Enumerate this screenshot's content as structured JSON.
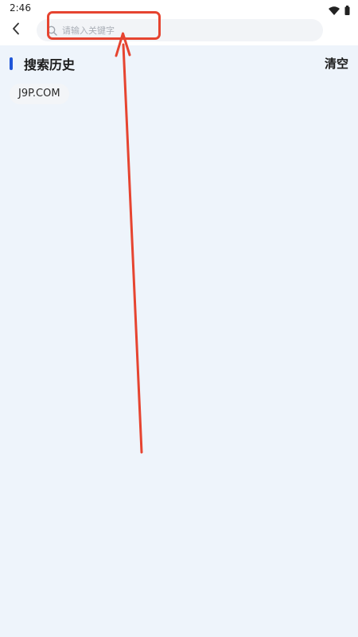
{
  "status_bar": {
    "time": "2:46",
    "icons": [
      "wifi-icon",
      "battery-icon"
    ]
  },
  "header": {
    "back_icon": "chevron-left-icon",
    "search": {
      "placeholder": "请输入关键字",
      "value": "",
      "icon": "search-icon"
    }
  },
  "history": {
    "title": "搜索历史",
    "clear_label": "清空",
    "items": [
      {
        "label": "J9P.COM"
      }
    ]
  },
  "colors": {
    "accent": "#1f56d8",
    "background": "#eef4fb",
    "annotation": "#e64430"
  }
}
